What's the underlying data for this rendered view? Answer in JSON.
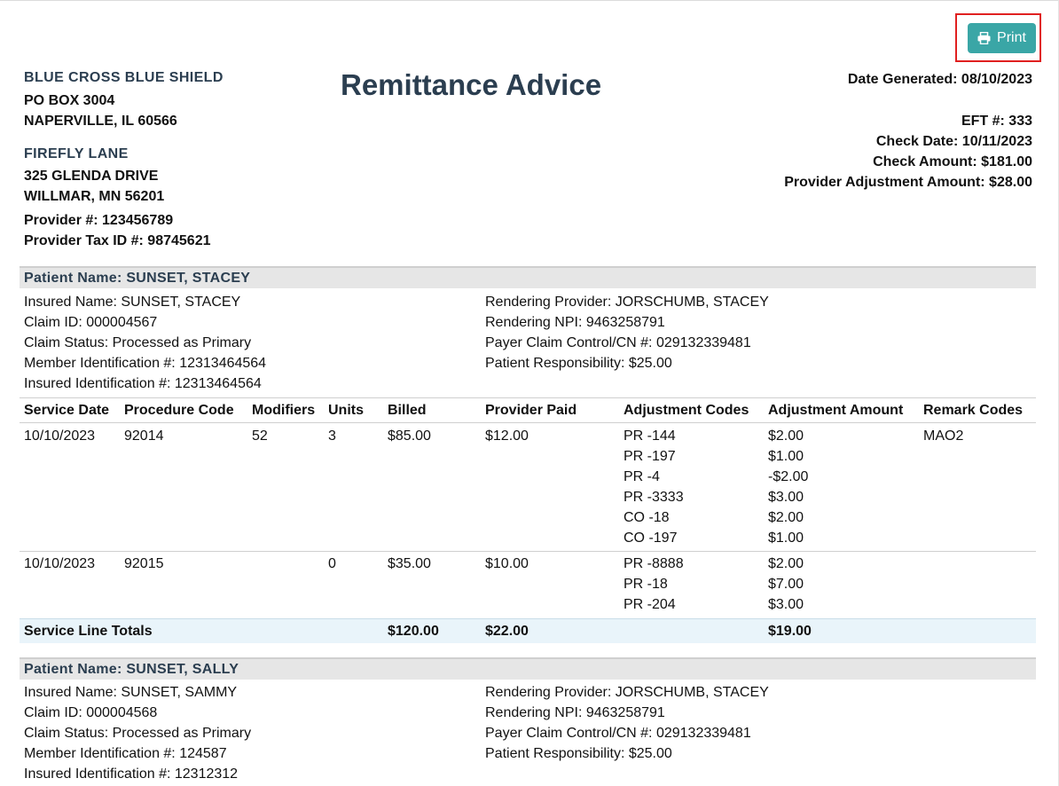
{
  "print_button": {
    "label": "Print",
    "icon": "printer-icon",
    "color": "#3aa6a6",
    "highlight": "#e02020"
  },
  "payer": {
    "name": "BLUE CROSS BLUE SHIELD",
    "address1": "PO BOX 3004",
    "address2": "NAPERVILLE, IL 60566"
  },
  "provider": {
    "name": "FIREFLY LANE",
    "address1": "325 GLENDA DRIVE",
    "address2": "WILLMAR, MN 56201",
    "provider_number": "Provider #: 123456789",
    "tax_id": "Provider Tax ID #: 98745621"
  },
  "title": "Remittance Advice",
  "summary": {
    "date_generated": "Date Generated: 08/10/2023",
    "eft": "EFT #: 333",
    "check_date": "Check Date: 10/11/2023",
    "check_amount": "Check Amount: $181.00",
    "provider_adjustment": "Provider Adjustment Amount: $28.00"
  },
  "claims": [
    {
      "patient": "Patient Name: SUNSET, STACEY",
      "left": [
        "Insured Name: SUNSET, STACEY",
        "Claim ID: 000004567",
        "Claim Status: Processed as Primary",
        "Member Identification #: 12313464564",
        "Insured Identification #: 12313464564"
      ],
      "right": [
        "Rendering Provider: JORSCHUMB, STACEY",
        "Rendering NPI: 9463258791",
        "Payer Claim Control/CN #: 029132339481",
        "Patient Responsibility: $25.00"
      ],
      "headers": [
        "Service Date",
        "Procedure Code",
        "Modifiers",
        "Units",
        "Billed",
        "Provider Paid",
        "Adjustment Codes",
        "Adjustment Amount",
        "Remark Codes"
      ],
      "lines": [
        {
          "service_date": "10/10/2023",
          "procedure": "92014",
          "modifiers": "52",
          "units": "3",
          "billed": "$85.00",
          "paid": "$12.00",
          "adj_codes": [
            "PR -144",
            "PR -197",
            "PR -4",
            "PR -3333",
            "CO -18",
            "CO -197"
          ],
          "adj_amounts": [
            "$2.00",
            "$1.00",
            "-$2.00",
            "$3.00",
            "$2.00",
            "$1.00"
          ],
          "remark": "MAO2"
        },
        {
          "service_date": "10/10/2023",
          "procedure": "92015",
          "modifiers": "",
          "units": "0",
          "billed": "$35.00",
          "paid": "$10.00",
          "adj_codes": [
            "PR -8888",
            "PR -18",
            "PR -204"
          ],
          "adj_amounts": [
            "$2.00",
            "$7.00",
            "$3.00"
          ],
          "remark": ""
        }
      ],
      "totals": {
        "label": "Service Line Totals",
        "billed": "$120.00",
        "paid": "$22.00",
        "adjustment": "$19.00"
      }
    },
    {
      "patient": "Patient Name: SUNSET, SALLY",
      "left": [
        "Insured Name: SUNSET, SAMMY",
        "Claim ID: 000004568",
        "Claim Status: Processed as Primary",
        "Member Identification #: 124587",
        "Insured Identification #: 12312312"
      ],
      "right": [
        "Rendering Provider: JORSCHUMB, STACEY",
        "Rendering NPI: 9463258791",
        "Payer Claim Control/CN #: 029132339481",
        "Patient Responsibility: $25.00"
      ]
    }
  ]
}
